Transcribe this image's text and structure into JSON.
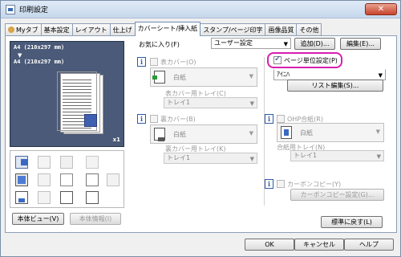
{
  "window": {
    "title": "印刷設定",
    "close_glyph": "✕"
  },
  "tabs": [
    {
      "label": "Myタブ"
    },
    {
      "label": "基本設定"
    },
    {
      "label": "レイアウト"
    },
    {
      "label": "仕上げ"
    },
    {
      "label": "カバーシート/挿入紙"
    },
    {
      "label": "スタンプ/ページ印字"
    },
    {
      "label": "画像品質"
    },
    {
      "label": "その他"
    }
  ],
  "preview": {
    "line1": "A4 (210x297 mm)",
    "arrow": "▼",
    "line2": "A4 (210x297 mm)",
    "copies": "x1"
  },
  "left_buttons": {
    "preview_label": "本体ビュー(V)",
    "info_label": "本体情報(I)"
  },
  "favorites": {
    "label": "お気に入り(F)",
    "value": "ユーザー設定",
    "add_label": "追加(D)...",
    "edit_label": "編集(E)..."
  },
  "front_cover": {
    "label": "表カバー(O)",
    "paper": "白紙",
    "tray_label": "表カバー用トレイ(C)",
    "tray_value": "トレイ1"
  },
  "back_cover": {
    "label": "裏カバー(B)",
    "paper": "白紙",
    "tray_label": "裏カバー用トレイ(K)",
    "tray_value": "トレイ1"
  },
  "per_page": {
    "label": "ページ単位設定(P)",
    "value": "ｱｲﾆﾊ",
    "list_edit_label": "リスト編集(S)..."
  },
  "ohp": {
    "label": "OHP合紙(R)",
    "paper": "白紙",
    "tray_label": "合紙用トレイ(N)",
    "tray_value": "トレイ1"
  },
  "carbon": {
    "label": "カーボンコピー(Y)",
    "settings_label": "カーボンコピー設定(G)..."
  },
  "restore_label": "標準に戻す(L)",
  "footer": {
    "ok": "OK",
    "cancel": "キャンセル",
    "help": "ヘルプ"
  },
  "info_glyph": "i",
  "dropdown_glyph": "▼",
  "colors": {
    "highlight": "#d61fb3",
    "preview_bg": "#4a5a78",
    "accent": "#2e5aa6"
  }
}
